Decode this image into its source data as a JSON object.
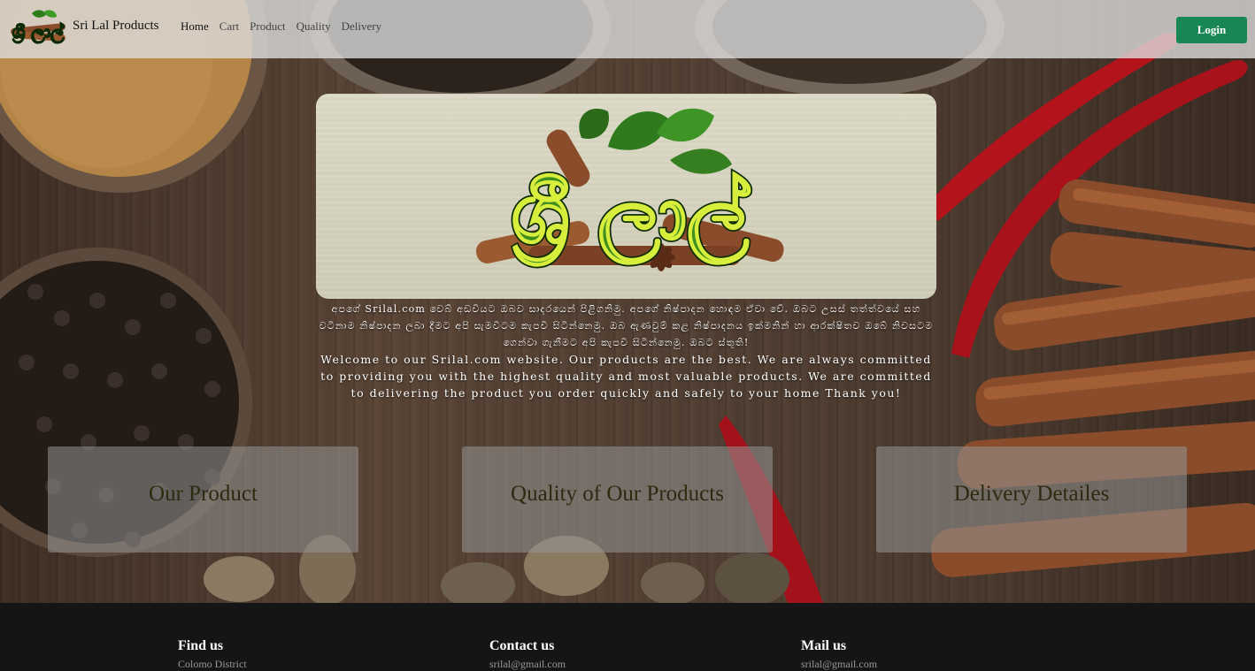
{
  "brand": {
    "name": "Sri Lal Products",
    "logo_text": "ශ්‍රී ලාල්"
  },
  "nav": {
    "items": [
      {
        "label": "Home",
        "active": true
      },
      {
        "label": "Cart",
        "active": false
      },
      {
        "label": "Product",
        "active": false
      },
      {
        "label": "Quality",
        "active": false
      },
      {
        "label": "Delivery",
        "active": false
      }
    ],
    "login_label": "Login"
  },
  "hero": {
    "logo_text": "ශ්‍රී ලාල්",
    "text_si": "අපගේ Srilal.com වෙබ් අඩවියට ඔබව සාදරයෙන් පිළිගනිමු. අපගේ නිෂ්පාදන හොඳම ඒවා වේ. ඔබට උසස් තත්ත්වයේ සහ වටිනාම නිෂ්පාදන ලබා දීමට අපි සැමවිටම කැපවී සිටින්නෙමු. ඔබ ඇණවුම් කළ නිෂ්පාදනය ඉක්මනින් හා ආරක්ෂිතව ඔබේ නිවසටම ගෙන්වා ගැනීමට අපි කැපවී සිටින්නෙමු. ඔබට ස්තූති!",
    "text_en": "Welcome to our Srilal.com website. Our products are the best. We are always committed to providing you with the highest quality and most valuable products. We are committed to delivering the product you order quickly and safely to your home Thank you!"
  },
  "features": [
    {
      "label": "Our Product"
    },
    {
      "label": "Quality of Our Products"
    },
    {
      "label": "Delivery Detailes"
    }
  ],
  "footer": {
    "columns": [
      {
        "title": "Find us",
        "value": "Colomo District"
      },
      {
        "title": "Contact us",
        "value": "srilal@gmail.com"
      },
      {
        "title": "Mail us",
        "value": "srilal@gmail.com"
      }
    ]
  },
  "colors": {
    "login_button": "#198754",
    "footer_bg": "#151515",
    "logo_green": "#3f8f1e",
    "chili_red": "#b3141b"
  }
}
